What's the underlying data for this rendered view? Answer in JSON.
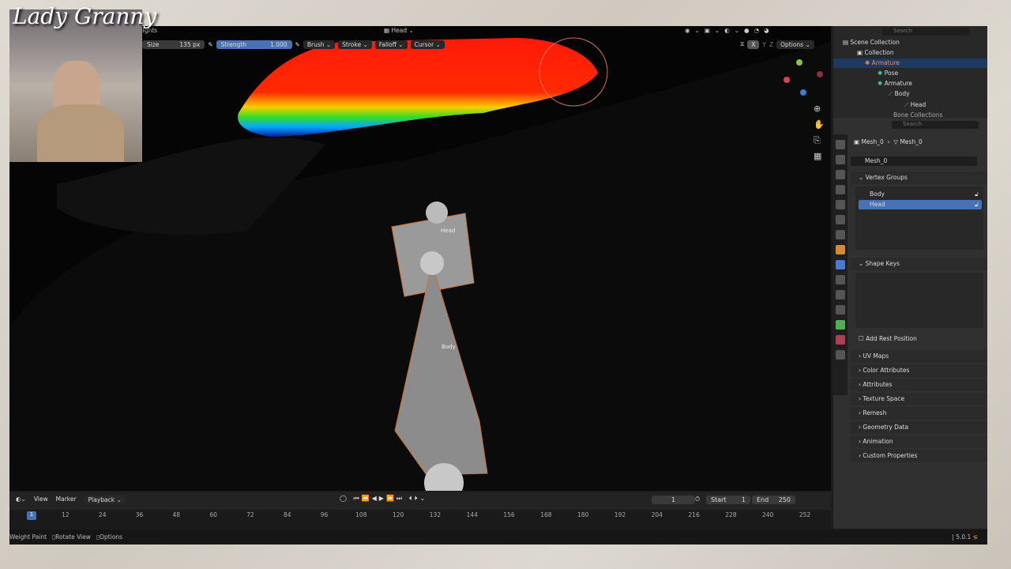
{
  "overlay": {
    "logo_text": "Lady Granny"
  },
  "viewport": {
    "mode_label_partial": "eights",
    "bone_selector": "Head",
    "toolbar": {
      "size_label": "Size",
      "size_value": "135 px",
      "strength_label": "Strength",
      "strength_value": "1.000",
      "brush": "Brush",
      "stroke": "Stroke",
      "falloff": "Falloff",
      "cursor": "Cursor"
    },
    "axes": [
      "X",
      "Y",
      "Z"
    ],
    "options": "Options",
    "bone_labels": [
      "Head",
      "Body"
    ],
    "accent": "#4772b3"
  },
  "outliner": {
    "search_placeholder": "Search",
    "items": [
      {
        "label": "Scene Collection",
        "indent": 0
      },
      {
        "label": "Collection",
        "indent": 1
      },
      {
        "label": "Armature",
        "indent": 2,
        "selected": true
      },
      {
        "label": "Pose",
        "indent": 3
      },
      {
        "label": "Armature",
        "indent": 3
      },
      {
        "label": "Body",
        "indent": 4
      },
      {
        "label": "Head",
        "indent": 5
      },
      {
        "label": "Bone Collections",
        "indent": 4
      }
    ]
  },
  "properties": {
    "search_placeholder": "Search",
    "breadcrumb": [
      "Mesh_0",
      "Mesh_0"
    ],
    "mesh_name": "Mesh_0",
    "vertex_groups_title": "Vertex Groups",
    "vertex_groups": [
      {
        "name": "Body",
        "selected": false
      },
      {
        "name": "Head",
        "selected": true
      }
    ],
    "shape_keys_title": "Shape Keys",
    "add_rest_position": "Add Rest Position",
    "sections": [
      "UV Maps",
      "Color Attributes",
      "Attributes",
      "Texture Space",
      "Remesh",
      "Geometry Data",
      "Animation",
      "Custom Properties"
    ]
  },
  "timeline": {
    "menus": [
      "View",
      "Marker",
      "Playback"
    ],
    "current_frame": "1",
    "start_label": "Start",
    "start": "1",
    "end_label": "End",
    "end": "250",
    "ticks": [
      "12",
      "24",
      "36",
      "48",
      "60",
      "72",
      "84",
      "96",
      "108",
      "120",
      "132",
      "144",
      "156",
      "168",
      "180",
      "192",
      "204",
      "216",
      "228",
      "240",
      "252"
    ],
    "playhead": "1"
  },
  "status": {
    "mode": "Weight Paint",
    "rotate": "Rotate View",
    "options": "Options",
    "version": "5.0.1"
  }
}
